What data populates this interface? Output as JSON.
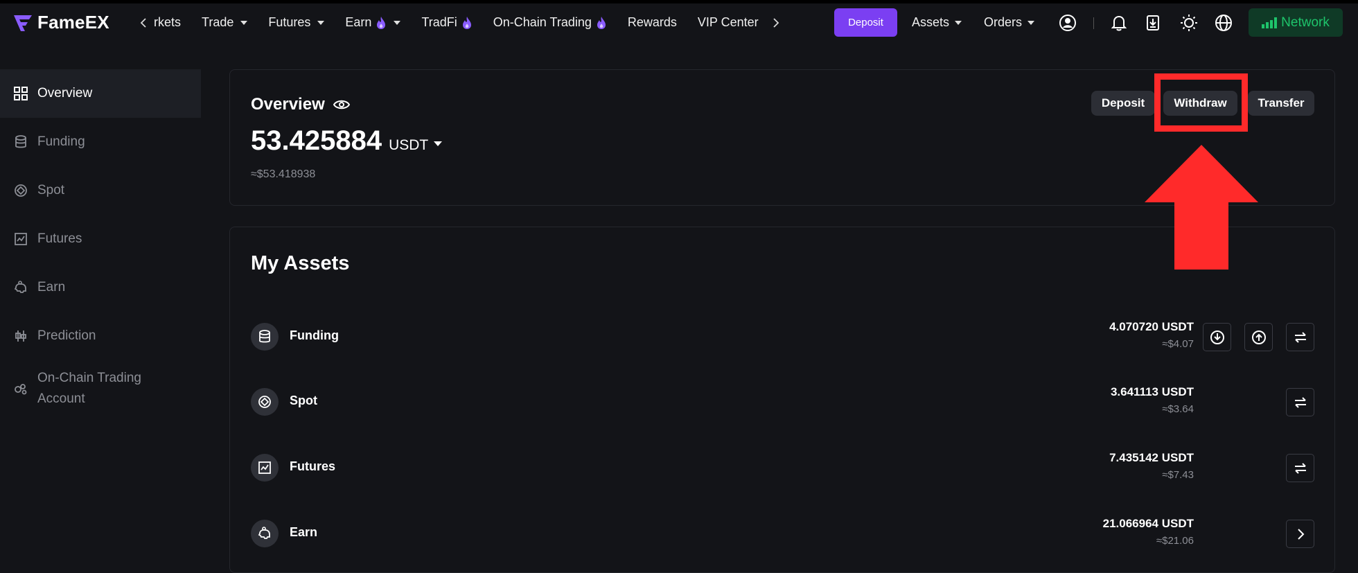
{
  "header": {
    "logo_text": "FameEX",
    "nav": [
      {
        "label": "rkets"
      },
      {
        "label": "Trade"
      },
      {
        "label": "Futures"
      },
      {
        "label": "Earn"
      },
      {
        "label": "TradFi"
      },
      {
        "label": "On-Chain Trading"
      },
      {
        "label": "Rewards"
      },
      {
        "label": "VIP Center"
      }
    ],
    "deposit_label": "Deposit",
    "assets_label": "Assets",
    "orders_label": "Orders",
    "network_label": "Network",
    "icons": [
      "user-icon",
      "bell-icon",
      "download-icon",
      "sun-icon",
      "globe-icon",
      "signal-icon"
    ]
  },
  "sidebar": {
    "items": [
      {
        "label": "Overview",
        "icon": "grid-icon",
        "active": true
      },
      {
        "label": "Funding",
        "icon": "database-icon"
      },
      {
        "label": "Spot",
        "icon": "spot-icon"
      },
      {
        "label": "Futures",
        "icon": "chart-icon"
      },
      {
        "label": "Earn",
        "icon": "piggy-icon"
      },
      {
        "label": "Prediction",
        "icon": "candles-icon"
      },
      {
        "label_line1": "On-Chain Trading",
        "label_line2": "Account",
        "icon": "chain-icon"
      }
    ]
  },
  "overview": {
    "title": "Overview",
    "amount": "53.425884",
    "currency": "USDT",
    "usd_value": "≈$53.418938",
    "buttons": {
      "deposit": "Deposit",
      "withdraw": "Withdraw",
      "transfer": "Transfer"
    }
  },
  "assets": {
    "title": "My Assets",
    "rows": [
      {
        "name": "Funding",
        "amount": "4.070720 USDT",
        "usd": "≈$4.07"
      },
      {
        "name": "Spot",
        "amount": "3.641113 USDT",
        "usd": "≈$3.64"
      },
      {
        "name": "Futures",
        "amount": "7.435142 USDT",
        "usd": "≈$7.43"
      },
      {
        "name": "Earn",
        "amount": "21.066964 USDT",
        "usd": "≈$21.06"
      }
    ]
  },
  "colors": {
    "background": "#131418",
    "accent": "#7b3ff2",
    "network_green": "#1ec46b",
    "annotation_red": "#ff2a2a"
  }
}
